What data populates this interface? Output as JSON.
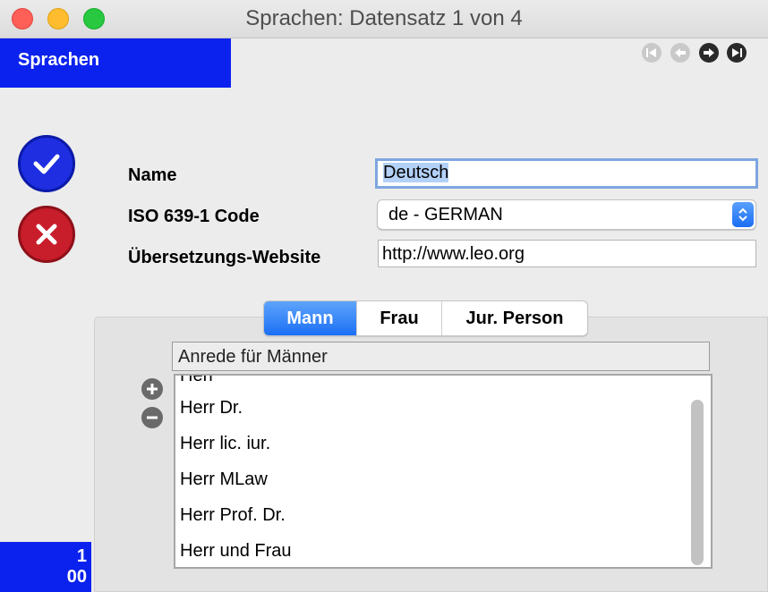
{
  "window": {
    "title": "Sprachen: Datensatz 1 von 4"
  },
  "header": {
    "tab_label": "Sprachen"
  },
  "record_nav": {
    "first_icon": "first-record-icon",
    "prev_icon": "prev-record-icon",
    "next_icon": "next-record-icon",
    "last_icon": "last-record-icon"
  },
  "actions": {
    "confirm_icon": "checkmark-icon",
    "cancel_icon": "x-icon"
  },
  "form": {
    "name_label": "Name",
    "name_value": "Deutsch",
    "iso_label": "ISO 639-1 Code",
    "iso_value": "de - GERMAN",
    "website_label": "Übersetzungs-Website",
    "website_value": "http://www.leo.org"
  },
  "tabs": [
    {
      "label": "Mann",
      "active": true
    },
    {
      "label": "Frau",
      "active": false
    },
    {
      "label": "Jur. Person",
      "active": false
    }
  ],
  "list": {
    "header": "Anrede für Männer",
    "items": [
      "Herr",
      "Herr Dr.",
      "Herr lic. iur.",
      "Herr MLaw",
      "Herr Prof. Dr.",
      "Herr und Frau"
    ],
    "add_icon": "plus-icon",
    "remove_icon": "minus-icon"
  },
  "counter": {
    "line1": "1",
    "line2": "00"
  },
  "colors": {
    "accent_blue": "#0b22ee",
    "confirm_blue": "#1e2ee0",
    "cancel_red": "#c81d2b",
    "segment_active": "#1b6ff5"
  }
}
